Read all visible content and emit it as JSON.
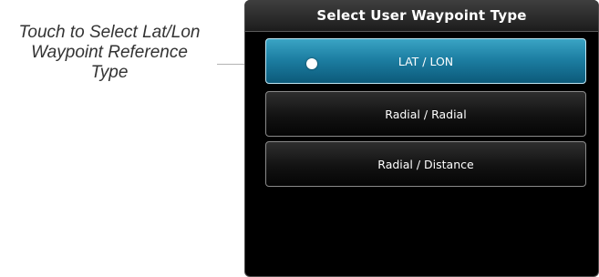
{
  "callout": {
    "lines": [
      "Touch to Select Lat/Lon",
      "Waypoint Reference",
      "Type"
    ]
  },
  "dialog": {
    "title": "Select User Waypoint Type",
    "options": [
      {
        "label": "LAT / LON",
        "selected": true
      },
      {
        "label": "Radial / Radial",
        "selected": false
      },
      {
        "label": "Radial / Distance",
        "selected": false
      }
    ]
  },
  "colors": {
    "selected_button": "#1d7fa3",
    "panel_background": "#000000",
    "callout_text": "#333333"
  }
}
